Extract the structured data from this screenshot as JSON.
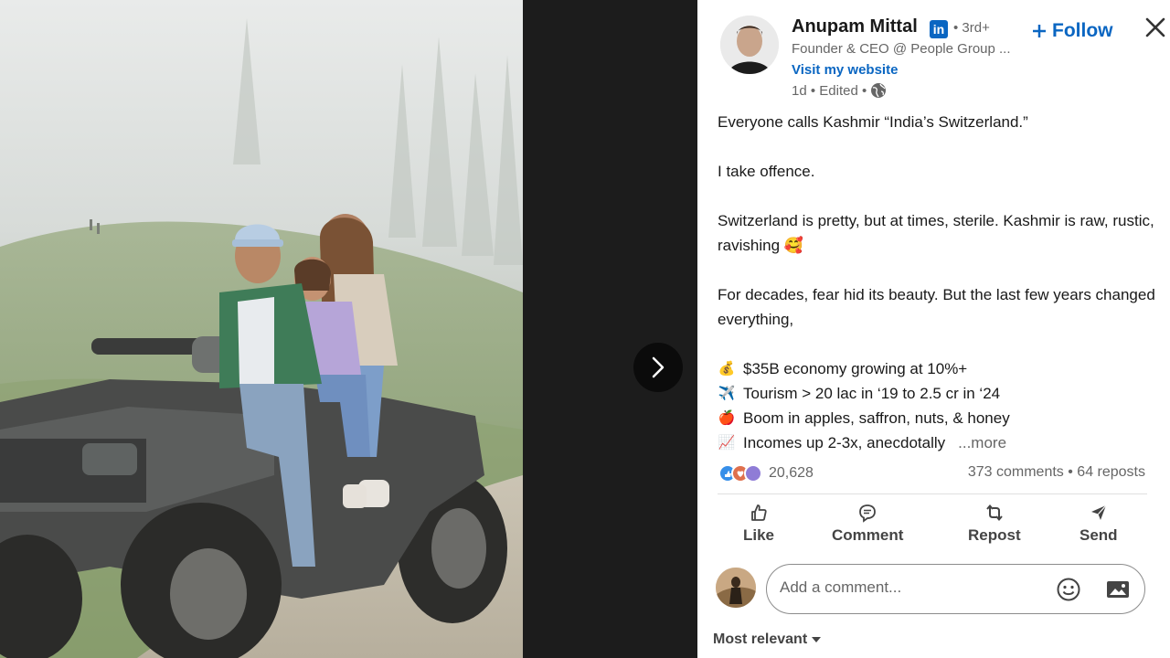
{
  "author": {
    "name": "Anupam Mittal",
    "badge": "in",
    "degree": "• 3rd+",
    "headline": "Founder & CEO @ People Group ...",
    "website_label": "Visit my website",
    "time": "1d • Edited •"
  },
  "follow_label": "Follow",
  "post": {
    "line1": "Everyone calls Kashmir “India’s Switzerland.”",
    "line2": "I take offence.",
    "line3": "Switzerland is pretty, but at times, sterile. Kashmir is raw, rustic, ravishing",
    "line3_emoji": "🥰",
    "line4": "For decades, fear hid its beauty. But the last few years changed everything,",
    "bullets": [
      {
        "emoji": "💰",
        "text": "$35B economy growing at 10%+"
      },
      {
        "emoji": "✈️",
        "text": "Tourism > 20 lac in ‘19 to 2.5 cr in ‘24"
      },
      {
        "emoji": "🍎",
        "text": "Boom in apples, saffron, nuts, & honey"
      },
      {
        "emoji": "📈",
        "text": "Incomes up 2-3x, anecdotally"
      }
    ],
    "more_label": "...more"
  },
  "social": {
    "reaction_count": "20,628",
    "counts": "373 comments • 64 reposts"
  },
  "actions": {
    "like": "Like",
    "comment": "Comment",
    "repost": "Repost",
    "send": "Send"
  },
  "comment": {
    "placeholder": "Add a comment..."
  },
  "sort_label": "Most relevant",
  "colors": {
    "brand": "#0a66c2",
    "text": "#191919",
    "muted": "#666666"
  },
  "icons": {
    "next": "chevron-right-icon",
    "close": "close-icon",
    "globe": "globe-icon",
    "like": "thumbs-up-icon",
    "comment": "speech-bubble-icon",
    "repost": "repost-arrows-icon",
    "send": "paper-plane-icon",
    "emoji": "smiley-icon",
    "photo": "image-icon"
  }
}
